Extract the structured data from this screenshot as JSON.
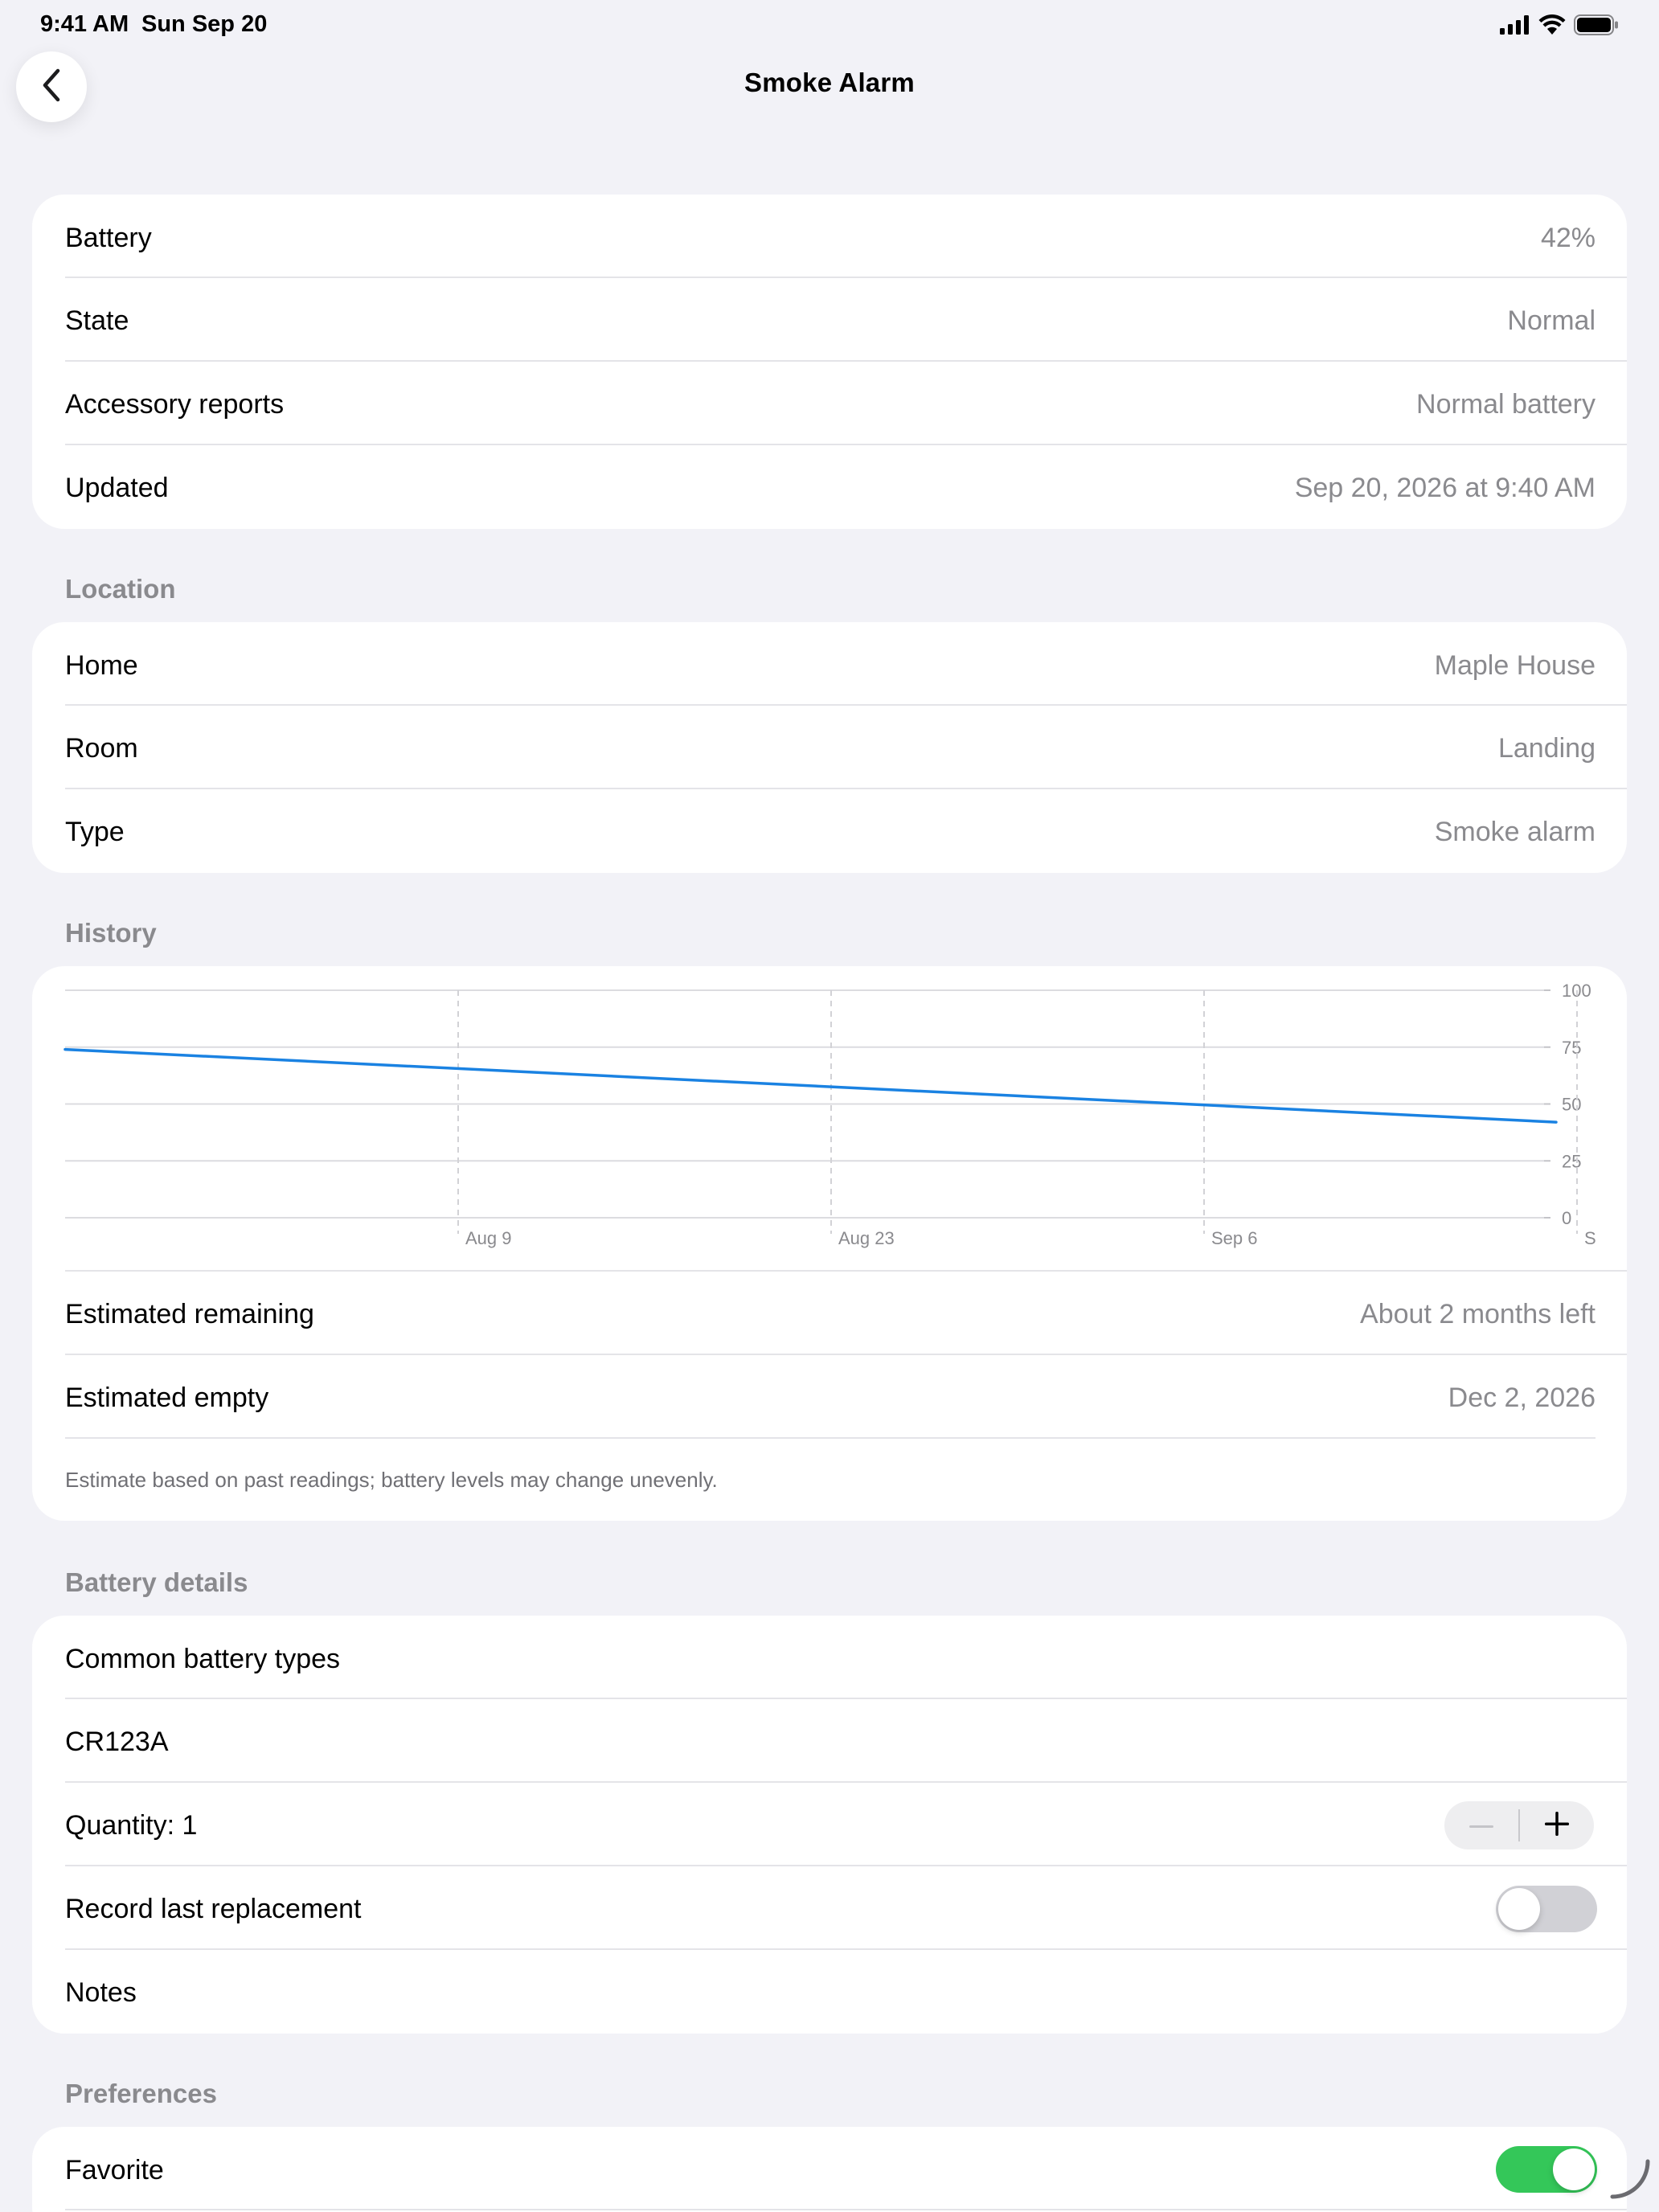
{
  "status": {
    "time": "9:41 AM",
    "date": "Sun Sep 20",
    "icons": [
      "cellular-signal-icon",
      "wifi-icon",
      "battery-full-icon"
    ]
  },
  "nav": {
    "back_icon": "chevron-left-icon",
    "title": "Smoke Alarm"
  },
  "summary": {
    "rows": [
      {
        "label": "Battery",
        "value": "42%"
      },
      {
        "label": "State",
        "value": "Normal"
      },
      {
        "label": "Accessory reports",
        "value": "Normal battery"
      },
      {
        "label": "Updated",
        "value": "Sep 20, 2026 at 9:40 AM"
      }
    ]
  },
  "location": {
    "header": "Location",
    "rows": [
      {
        "label": "Home",
        "value": "Maple House"
      },
      {
        "label": "Room",
        "value": "Landing"
      },
      {
        "label": "Type",
        "value": "Smoke alarm"
      }
    ]
  },
  "history": {
    "header": "History",
    "rows": [
      {
        "label": "Estimated remaining",
        "value": "About 2 months left"
      },
      {
        "label": "Estimated empty",
        "value": "Dec 2, 2026"
      }
    ],
    "footnote": "Estimate based on past readings; battery levels may change unevenly."
  },
  "chart_data": {
    "type": "line",
    "x_tick_labels": [
      "Aug 9",
      "Aug 23",
      "Sep 6",
      "S"
    ],
    "y_tick_labels": [
      "100",
      "75",
      "50",
      "25",
      "0"
    ],
    "ylim": [
      0,
      100
    ],
    "grid": true,
    "series": [
      {
        "color": "#1a82e2",
        "x": [
          "Jul 26, 2026",
          "Sep 20, 2026"
        ],
        "values": [
          74,
          42
        ]
      }
    ]
  },
  "battery_details": {
    "header": "Battery details",
    "link_label": "Common battery types",
    "battery_type": "CR123A",
    "quantity_label": "Quantity: 1",
    "quantity": 1,
    "stepper_icons": [
      "minus-icon",
      "plus-icon"
    ],
    "replacement_label": "Record last replacement",
    "replacement_on": false,
    "notes_placeholder": "Notes"
  },
  "preferences": {
    "header": "Preferences",
    "favorite_label": "Favorite",
    "favorite_on": true
  },
  "colors": {
    "background": "#f2f2f7",
    "accent": "#1a82e2",
    "toggle_on": "#34c759",
    "secondary_text": "#8a8a8e"
  }
}
